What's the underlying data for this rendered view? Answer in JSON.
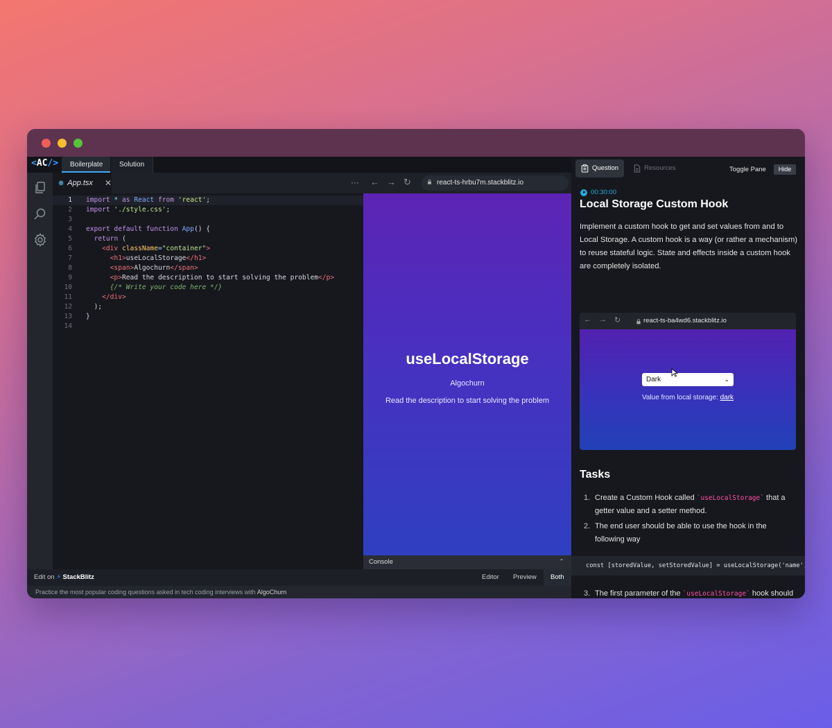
{
  "window": {
    "colors": {
      "accent": "#3fa9f5",
      "brand_purple": "#5d24b5",
      "link_blue": "#2aa8df",
      "pink_code": "#ff4fa7"
    }
  },
  "ide": {
    "logo": {
      "open": "<",
      "text": "AC",
      "close": "/>"
    },
    "tabs": [
      {
        "label": "Boilerplate",
        "active": true
      },
      {
        "label": "Solution",
        "active": false
      }
    ],
    "file_tab": {
      "name": "App.tsx",
      "close": "✕",
      "icon": "react-icon"
    },
    "more": "···",
    "activity_icons": [
      "files-icon",
      "search-icon",
      "gear-icon"
    ],
    "code_lines": [
      {
        "n": "1"
      },
      {
        "n": "2"
      },
      {
        "n": "3"
      },
      {
        "n": "4"
      },
      {
        "n": "5"
      },
      {
        "n": "6"
      },
      {
        "n": "7"
      },
      {
        "n": "8"
      },
      {
        "n": "9"
      },
      {
        "n": "10"
      },
      {
        "n": "11"
      },
      {
        "n": "12"
      },
      {
        "n": "13"
      },
      {
        "n": "14"
      }
    ],
    "code": {
      "l1": [
        "import",
        " * ",
        "as",
        " React ",
        "from",
        " 'react';"
      ],
      "l2": [
        "import",
        " './style.css';"
      ],
      "l4": [
        "export default function",
        " App",
        "() {"
      ],
      "l5": [
        "return",
        " ("
      ],
      "l6": [
        "<div ",
        "className",
        "=",
        "\"container\"",
        ">"
      ],
      "l7": [
        "<h1>",
        "useLocalStorage",
        "</h1>"
      ],
      "l8": [
        "<span>",
        "Algochurn",
        "</span>"
      ],
      "l9": [
        "<p>",
        "Read the description to start solving the problem",
        "</p>"
      ],
      "l10": [
        "{/* Write your code here */}"
      ],
      "l11": [
        "</div>"
      ],
      "l12": [
        ");"
      ],
      "l13": [
        "}"
      ]
    },
    "browser": {
      "url": "react-ts-hrbu7m.stackblitz.io",
      "preview_title": "useLocalStorage",
      "preview_sub": "Algochurn",
      "preview_desc": "Read the description to start solving the problem",
      "console_label": "Console"
    },
    "bottom": {
      "edit_on": "Edit on",
      "stackblitz": "StackBlitz",
      "views": [
        "Editor",
        "Preview",
        "Both"
      ],
      "active_view": "Both"
    },
    "footer": {
      "text": "Practice the most popular coding questions asked in tech coding interviews with",
      "brand": "AlgoChurn"
    }
  },
  "pane": {
    "tabs": [
      {
        "label": "Question",
        "active": true,
        "icon": "clipboard-icon"
      },
      {
        "label": "Resources",
        "active": false,
        "icon": "document-icon"
      }
    ],
    "toggle_label": "Toggle Pane",
    "hide_label": "Hide",
    "timer": "00:30:00",
    "title": "Local Storage Custom Hook",
    "description": "Implement a custom hook to get and set values from and to Local Storage. A custom hook is a way (or rather a mechanism) to reuse stateful logic. State and effects inside a custom hook are completely isolated.",
    "demo": {
      "url": "react-ts-ba4wd6.stackblitz.io",
      "select_value": "Dark",
      "value_label": "Value from local storage:",
      "value": "dark"
    },
    "tasks_title": "Tasks",
    "tasks": [
      {
        "num": "1.",
        "pre": "Create a Custom Hook called ",
        "code": "`useLocalStorage`",
        "post": " that a getter value and a setter method."
      },
      {
        "num": "2.",
        "pre": "The end user should be able to use the hook in the following way",
        "code": "",
        "post": ""
      },
      {
        "num": "3.",
        "pre": "The first parameter of the ",
        "code": "`useLocalStorage`",
        "post": " hook should"
      }
    ],
    "code_block": "const [storedValue, setStoredValue] = useLocalStorage('name', '"
  }
}
